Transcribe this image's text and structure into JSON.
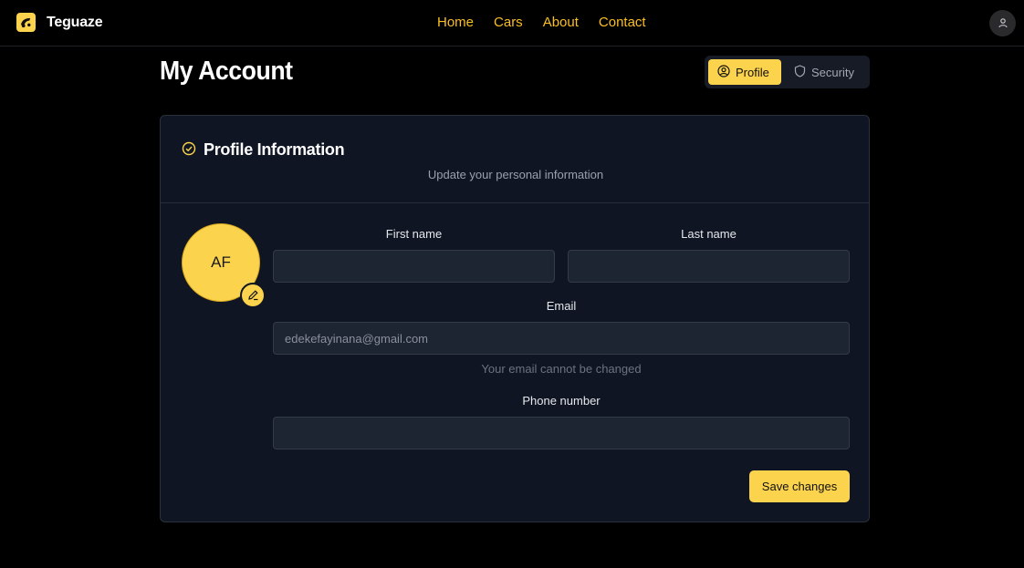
{
  "brand": {
    "name": "Teguaze",
    "logo_icon": "car-icon",
    "accent": "#fcd34d"
  },
  "nav": {
    "items": [
      {
        "label": "Home"
      },
      {
        "label": "Cars"
      },
      {
        "label": "About"
      },
      {
        "label": "Contact"
      }
    ]
  },
  "header": {
    "user_icon": "user-icon"
  },
  "page": {
    "title": "My Account"
  },
  "tabs": [
    {
      "label": "Profile",
      "icon": "user-circle-icon",
      "active": true
    },
    {
      "label": "Security",
      "icon": "shield-icon",
      "active": false
    }
  ],
  "profile_card": {
    "title": "Profile Information",
    "title_icon": "check-circle-icon",
    "subtitle": "Update your personal information",
    "avatar_initials": "AF",
    "avatar_edit_icon": "pencil-icon",
    "fields": {
      "first_name": {
        "label": "First name",
        "value": ""
      },
      "last_name": {
        "label": "Last name",
        "value": ""
      },
      "email": {
        "label": "Email",
        "placeholder": "edekefayinana@gmail.com",
        "helper": "Your email cannot be changed"
      },
      "phone": {
        "label": "Phone number",
        "value": ""
      }
    },
    "save_label": "Save changes"
  }
}
